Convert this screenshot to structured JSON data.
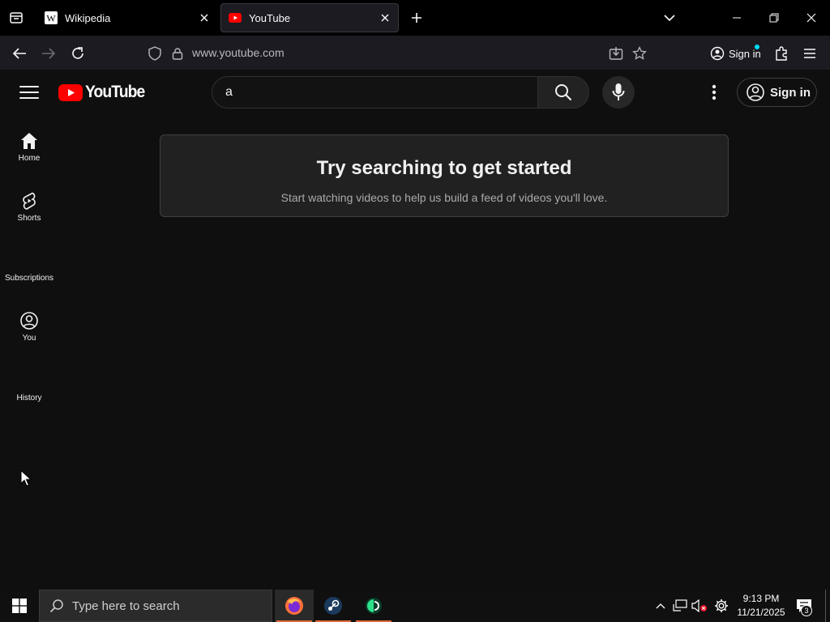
{
  "browser": {
    "tabs": [
      {
        "title": "Wikipedia",
        "favicon": "wikipedia-icon",
        "active": false
      },
      {
        "title": "YouTube",
        "favicon": "youtube-icon",
        "active": true
      }
    ],
    "url": "www.youtube.com",
    "signin_label": "Sign in"
  },
  "youtube": {
    "logo_text": "YouTube",
    "search_value": "a",
    "signin_label": "Sign in",
    "guide": [
      {
        "label": "Home",
        "icon": "home-icon"
      },
      {
        "label": "Shorts",
        "icon": "shorts-icon"
      },
      {
        "label": "Subscriptions",
        "icon": "subscriptions-icon"
      },
      {
        "label": "You",
        "icon": "you-icon"
      },
      {
        "label": "History",
        "icon": "history-icon"
      }
    ],
    "prompt": {
      "title": "Try searching to get started",
      "subtitle": "Start watching videos to help us build a feed of videos you'll love."
    }
  },
  "taskbar": {
    "search_placeholder": "Type here to search",
    "time": "9:13 PM",
    "date": "11/21/2025",
    "notification_count": "3"
  },
  "colors": {
    "yt_red": "#ff0000",
    "background": "#0f0f0f",
    "firefox_accent": "#e06a3a"
  }
}
